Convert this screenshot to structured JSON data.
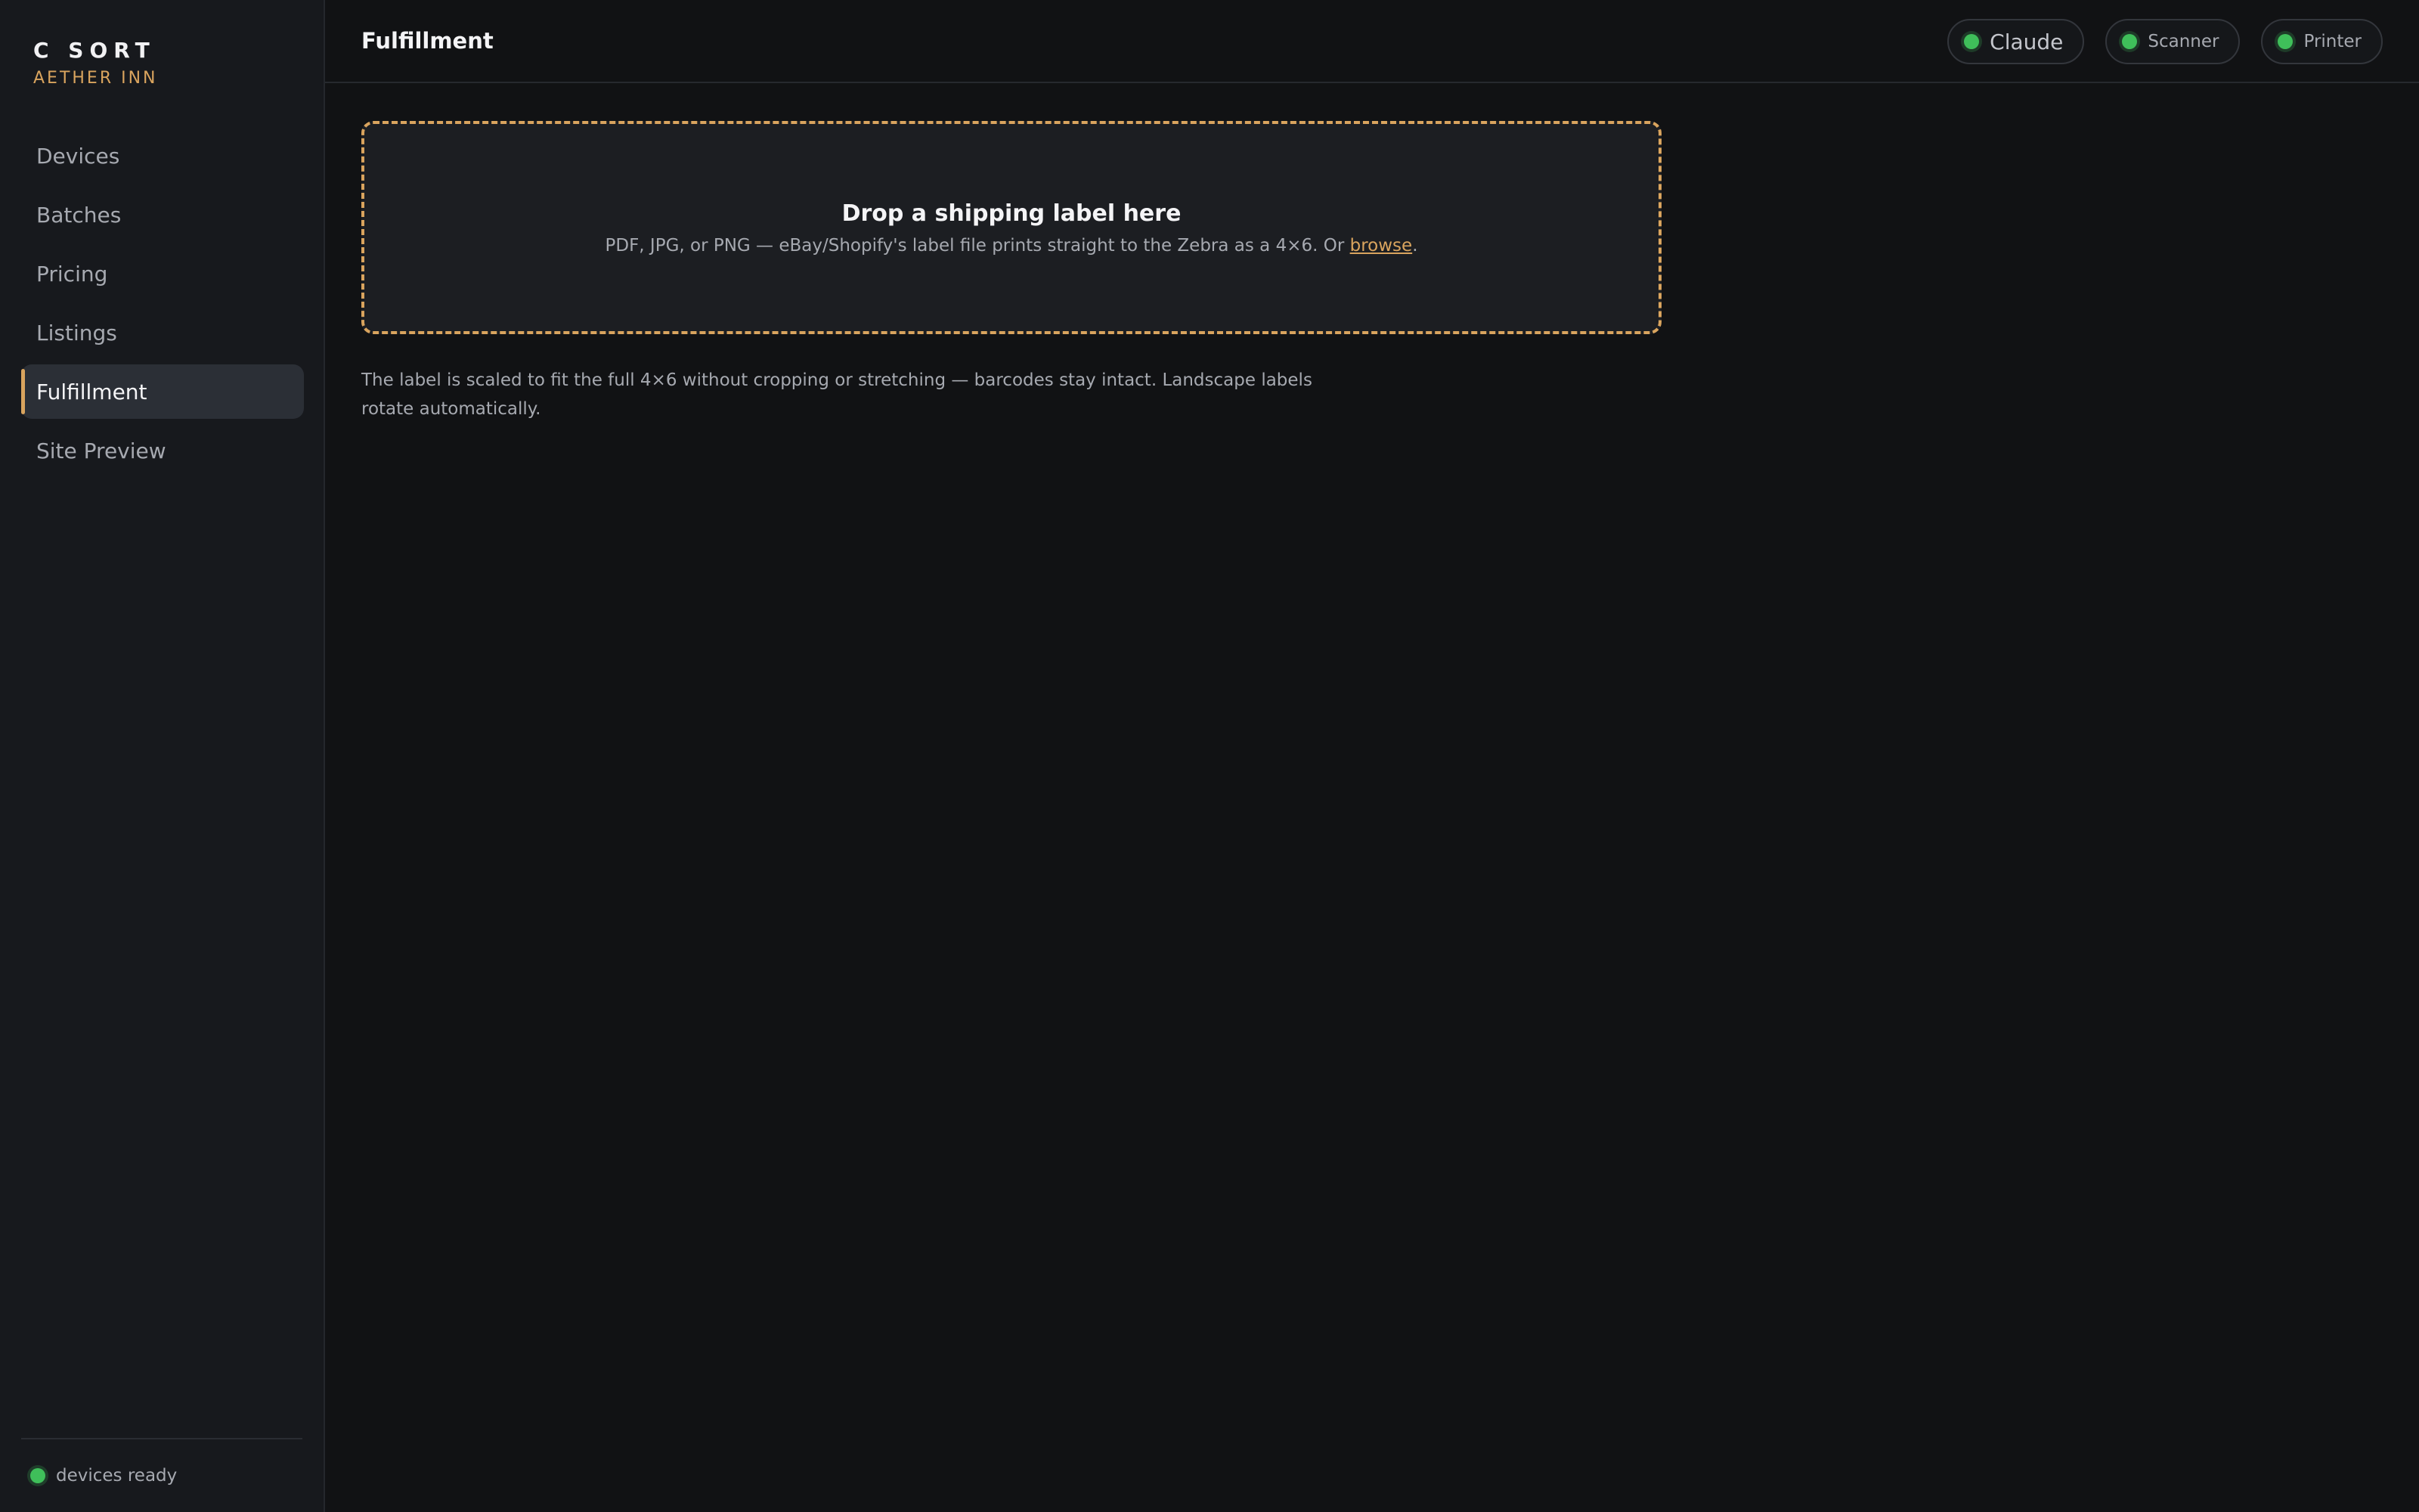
{
  "brand": {
    "title": "C SORT",
    "subtitle": "AETHER INN"
  },
  "sidebar": {
    "items": [
      {
        "label": "Devices",
        "active": false
      },
      {
        "label": "Batches",
        "active": false
      },
      {
        "label": "Pricing",
        "active": false
      },
      {
        "label": "Listings",
        "active": false
      },
      {
        "label": "Fulfillment",
        "active": true
      },
      {
        "label": "Site Preview",
        "active": false
      }
    ],
    "footer": {
      "status_text": "devices ready"
    }
  },
  "header": {
    "title": "Fulfillment",
    "status": [
      {
        "label": "Claude",
        "state": "online"
      },
      {
        "label": "Scanner",
        "state": "online"
      },
      {
        "label": "Printer",
        "state": "online"
      }
    ]
  },
  "dropzone": {
    "title": "Drop a shipping label here",
    "description": "PDF, JPG, or PNG — eBay/Shopify's label file prints straight to the Zebra as a 4×6. Or",
    "link_label": "browse",
    "trailing": "."
  },
  "note": "The label is scaled to fit the full 4×6 without cropping or stretching — barcodes stay intact. Landscape labels rotate automatically.",
  "colors": {
    "accent": "#d9a45e",
    "status_ok": "#3fbf5a",
    "background": "#111214",
    "sidebar": "#17191d"
  }
}
